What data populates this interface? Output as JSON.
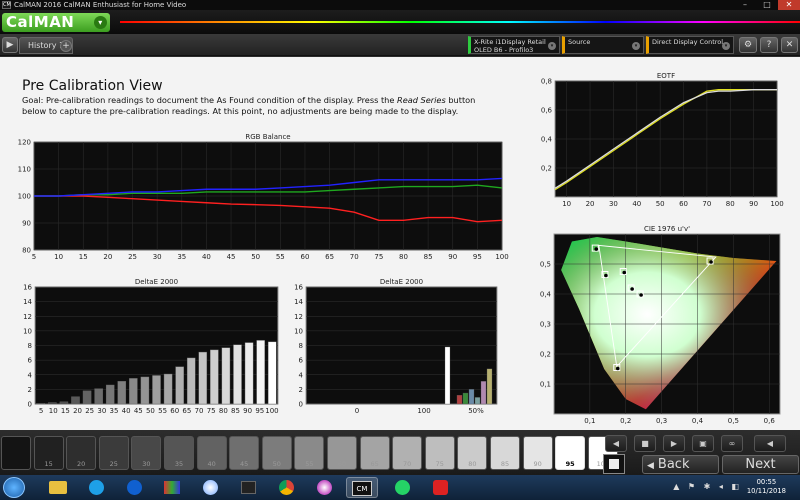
{
  "window": {
    "title": "CalMAN 2016 CalMAN Enthusiast for Home Video",
    "app_icon_text": "CM",
    "min": "–",
    "max": "□",
    "close": "✕"
  },
  "header": {
    "logo": "CalMAN",
    "logo_arrow": "▾"
  },
  "tabbar": {
    "back_icon": "▶",
    "tab": "History 1",
    "add": "+",
    "meter_line1": "X-Rite i1Display Retail",
    "meter_line2": "OLED B6 - Profilo3",
    "source": "Source",
    "display_control": "Direct Display Control",
    "caret": "▾",
    "settings_icon": "⚙",
    "help_icon": "?",
    "close_icon": "✕"
  },
  "page": {
    "title": "Pre Calibration View",
    "goal_prefix": "Goal: Pre-calibration readings to document the As Found condition of the display. Press the ",
    "goal_italic": "Read Series",
    "goal_suffix": " button below to capture the pre-calibration readings. At this point, no adjustments are being made to the display."
  },
  "colors": {
    "red": "#ff2020",
    "green": "#1fa81f",
    "blue": "#2222ff",
    "yellow": "#e0e020",
    "accent": "#3c9e20"
  },
  "chart_data": [
    {
      "type": "line",
      "title": "RGB Balance",
      "x": [
        5,
        10,
        15,
        20,
        25,
        30,
        35,
        40,
        45,
        50,
        55,
        60,
        65,
        70,
        75,
        80,
        85,
        90,
        95,
        100
      ],
      "xlim": [
        5,
        100
      ],
      "ylim": [
        80,
        120
      ],
      "yticks": [
        80,
        90,
        100,
        110,
        120
      ],
      "series": [
        {
          "color": "#ff2020",
          "values": [
            100,
            100,
            100,
            99.5,
            99,
            98.5,
            98,
            97.5,
            97,
            96.8,
            96.5,
            96,
            95.5,
            94,
            91,
            91,
            92,
            92,
            90.5,
            91
          ]
        },
        {
          "color": "#1fa81f",
          "values": [
            100,
            100,
            100.5,
            100.5,
            101,
            101,
            101,
            101.5,
            101.5,
            101.5,
            101.5,
            101.5,
            102,
            102.5,
            103,
            103.5,
            103.5,
            103.5,
            104,
            103
          ]
        },
        {
          "color": "#2222ff",
          "values": [
            100,
            100,
            100.5,
            101,
            101.5,
            101.5,
            102,
            102.5,
            102.5,
            102.5,
            103,
            103.5,
            104,
            105,
            106,
            106,
            106,
            106,
            106,
            106.5
          ]
        }
      ]
    },
    {
      "type": "line",
      "title": "EOTF",
      "x": [
        5,
        10,
        20,
        30,
        40,
        50,
        60,
        70,
        75,
        80,
        90,
        100
      ],
      "xlim": [
        5,
        100
      ],
      "ylim": [
        0,
        0.8
      ],
      "xticks": [
        10,
        20,
        30,
        40,
        50,
        60,
        70,
        80,
        90,
        100
      ],
      "yticks": [
        0.2,
        0.4,
        0.6,
        0.8
      ],
      "ytick_labels": [
        "0,2",
        "0,4",
        "0,6",
        "0,8"
      ],
      "series": [
        {
          "color": "#e0e020",
          "values": [
            0.05,
            0.1,
            0.21,
            0.32,
            0.43,
            0.54,
            0.64,
            0.73,
            0.74,
            0.74,
            0.74,
            0.74
          ]
        },
        {
          "color": "#dddddd",
          "values": [
            0.06,
            0.11,
            0.22,
            0.33,
            0.44,
            0.55,
            0.65,
            0.72,
            0.73,
            0.73,
            0.74,
            0.74
          ]
        }
      ]
    },
    {
      "type": "bar",
      "title": "DeltaE 2000",
      "categories": [
        "5",
        "10",
        "15",
        "20",
        "25",
        "30",
        "35",
        "40",
        "45",
        "50",
        "55",
        "60",
        "65",
        "70",
        "75",
        "80",
        "85",
        "90",
        "95",
        "100"
      ],
      "values": [
        0.1,
        0.2,
        0.3,
        1.0,
        1.8,
        2.1,
        2.6,
        3.1,
        3.5,
        3.7,
        3.9,
        4.1,
        5.1,
        6.3,
        7.1,
        7.4,
        7.7,
        8.1,
        8.4,
        8.7,
        8.5
      ],
      "ylim": [
        0,
        16
      ],
      "yticks": [
        0,
        2,
        4,
        6,
        8,
        10,
        12,
        14,
        16
      ]
    },
    {
      "type": "bar",
      "title": "DeltaE 2000",
      "x_axis": {
        "labels": [
          "0",
          "100",
          "50%"
        ]
      },
      "bars": [
        {
          "label": "white",
          "color": "#ffffff",
          "value": 7.8
        },
        {
          "label": "red",
          "color": "#b04040",
          "value": 1.2
        },
        {
          "label": "green",
          "color": "#3a8a3a",
          "value": 1.5
        },
        {
          "label": "blue",
          "color": "#6a8aa8",
          "value": 2.0
        },
        {
          "label": "cyan",
          "color": "#7aa0a0",
          "value": 0.9
        },
        {
          "label": "magenta",
          "color": "#b089b0",
          "value": 3.1
        },
        {
          "label": "yellow",
          "color": "#b6b070",
          "value": 4.8
        }
      ],
      "ylim": [
        0,
        16
      ],
      "yticks": [
        0,
        2,
        4,
        6,
        8,
        10,
        12,
        14,
        16
      ]
    },
    {
      "type": "scatter",
      "title": "CIE 1976 u'v'",
      "xlim": [
        0,
        0.63
      ],
      "ylim": [
        0,
        0.6
      ],
      "xticks": [
        0.1,
        0.2,
        0.3,
        0.4,
        0.5,
        0.6
      ],
      "xtick_labels": [
        "0,1",
        "0,2",
        "0,3",
        "0,4",
        "0,5",
        "0,6"
      ],
      "yticks": [
        0.1,
        0.2,
        0.3,
        0.4,
        0.5
      ],
      "ytick_labels": [
        "0,1",
        "0,2",
        "0,3",
        "0,4",
        "0,5"
      ],
      "points": [
        {
          "u": 0.115,
          "v": 0.553
        },
        {
          "u": 0.142,
          "v": 0.465
        },
        {
          "u": 0.193,
          "v": 0.475
        },
        {
          "u": 0.175,
          "v": 0.155
        },
        {
          "u": 0.215,
          "v": 0.42
        },
        {
          "u": 0.435,
          "v": 0.51
        },
        {
          "u": 0.24,
          "v": 0.4
        }
      ]
    }
  ],
  "patches": {
    "labels": [
      "15",
      "20",
      "25",
      "30",
      "35",
      "40",
      "45",
      "50",
      "55",
      "60",
      "65",
      "70",
      "75",
      "80",
      "85",
      "90",
      "95",
      "100"
    ],
    "selected": "95"
  },
  "controls": {
    "back": "Back",
    "next": "Next",
    "prev_icon": "◀",
    "stop_icon": "■",
    "play_icon": "▶",
    "save_icon": "▣",
    "loop_icon": "∞",
    "chevron_icon": "◀"
  },
  "taskbar": {
    "time": "00:55",
    "date": "10/11/2018",
    "cm_label": "CM",
    "tray": "▲ ⚑ ✱ ◂ ◧"
  }
}
